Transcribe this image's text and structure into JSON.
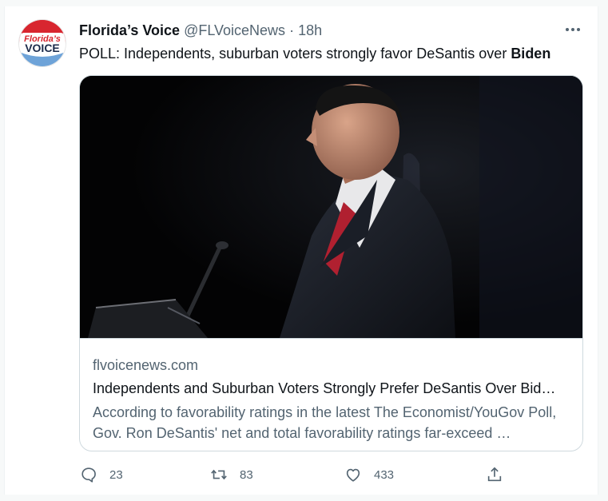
{
  "tweet": {
    "author_name": "Florida’s Voice",
    "author_handle": "@FLVoiceNews",
    "separator": "·",
    "time": "18h",
    "text_prefix": "POLL: Independents, suburban voters strongly favor DeSantis over ",
    "text_bold": "Biden",
    "avatar_logo_top": "Florida’s",
    "avatar_logo_bottom": "VOICE"
  },
  "card": {
    "domain": "flvoicenews.com",
    "title": "Independents and Suburban Voters Strongly Prefer DeSantis Over Bid…",
    "description": "According to favorability ratings in the latest The Economist/YouGov Poll, Gov. Ron DeSantis' net and total favorability ratings far-exceed …"
  },
  "actions": {
    "reply_count": "23",
    "retweet_count": "83",
    "like_count": "433"
  },
  "colors": {
    "accent_gray": "#536471",
    "text": "#0f1419",
    "border": "#cfd9de",
    "logo_red": "#d8262f",
    "logo_blue": "#6ea3d8"
  },
  "icons": [
    "more-icon",
    "reply-icon",
    "retweet-icon",
    "like-icon",
    "share-icon"
  ]
}
